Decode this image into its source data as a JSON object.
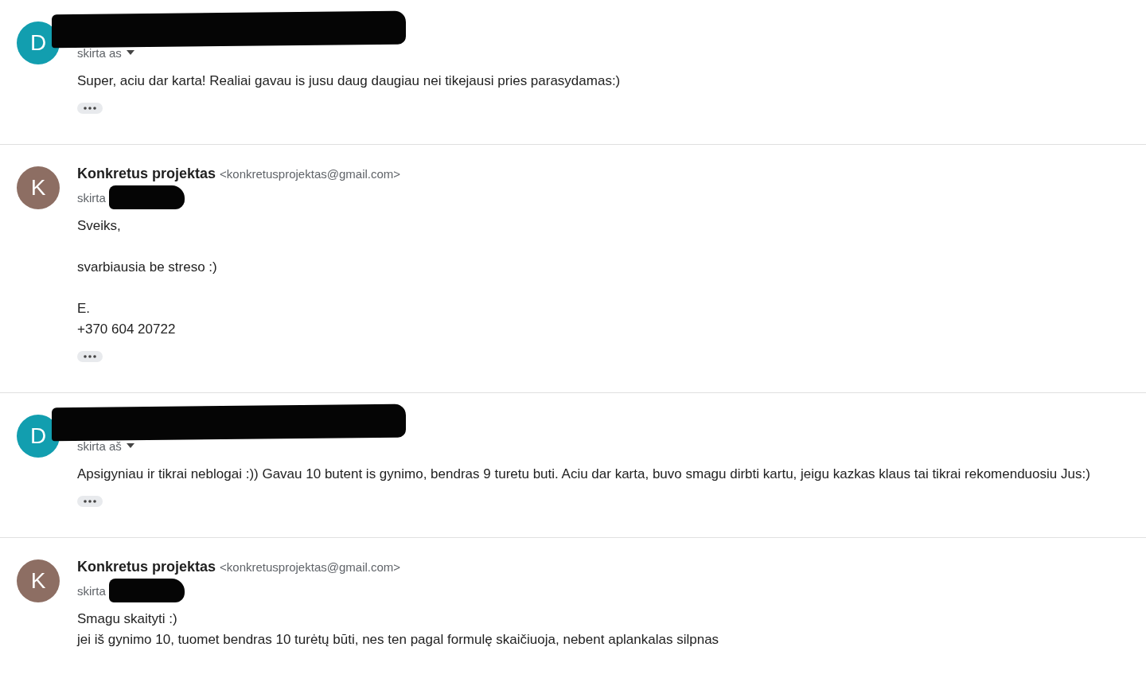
{
  "messages": [
    {
      "avatar": {
        "letter": "D",
        "color": "#129eaf"
      },
      "sender_redacted": true,
      "recipient": "skirta as",
      "recipient_redacted": false,
      "caret": true,
      "paragraphs": [
        [
          "Super, aciu dar karta! Realiai gavau is jusu daug daugiau nei tikejausi pries parasydamas:)"
        ]
      ],
      "trimmed_content": true
    },
    {
      "avatar": {
        "letter": "K",
        "color": "#8d6e63"
      },
      "sender": "Konkretus projektas",
      "email": "<konkretusprojektas@gmail.com>",
      "sender_redacted": false,
      "recipient": "skirta",
      "recipient_redacted": true,
      "caret": false,
      "paragraphs": [
        [
          "Sveiks,"
        ],
        [
          "svarbiausia be streso :)"
        ],
        [
          "E.",
          "+370 604 20722"
        ]
      ],
      "trimmed_content": true
    },
    {
      "avatar": {
        "letter": "D",
        "color": "#129eaf"
      },
      "sender_redacted": true,
      "recipient": "skirta aš",
      "recipient_redacted": false,
      "caret": true,
      "paragraphs": [
        [
          "Apsigyniau ir tikrai neblogai :)) Gavau 10 butent is gynimo, bendras 9 turetu buti. Aciu dar karta, buvo smagu dirbti kartu, jeigu kazkas klaus tai tikrai rekomenduosiu Jus:)"
        ]
      ],
      "trimmed_content": true
    },
    {
      "avatar": {
        "letter": "K",
        "color": "#8d6e63"
      },
      "sender": "Konkretus projektas",
      "email": "<konkretusprojektas@gmail.com>",
      "sender_redacted": false,
      "recipient": "skirta",
      "recipient_redacted": true,
      "caret": false,
      "paragraphs": [
        [
          "Smagu skaityti :)",
          "jei iš gynimo 10, tuomet bendras 10 turėtų būti, nes ten pagal formulę skaičiuoja, nebent aplankalas silpnas"
        ]
      ],
      "trimmed_content": false
    }
  ]
}
